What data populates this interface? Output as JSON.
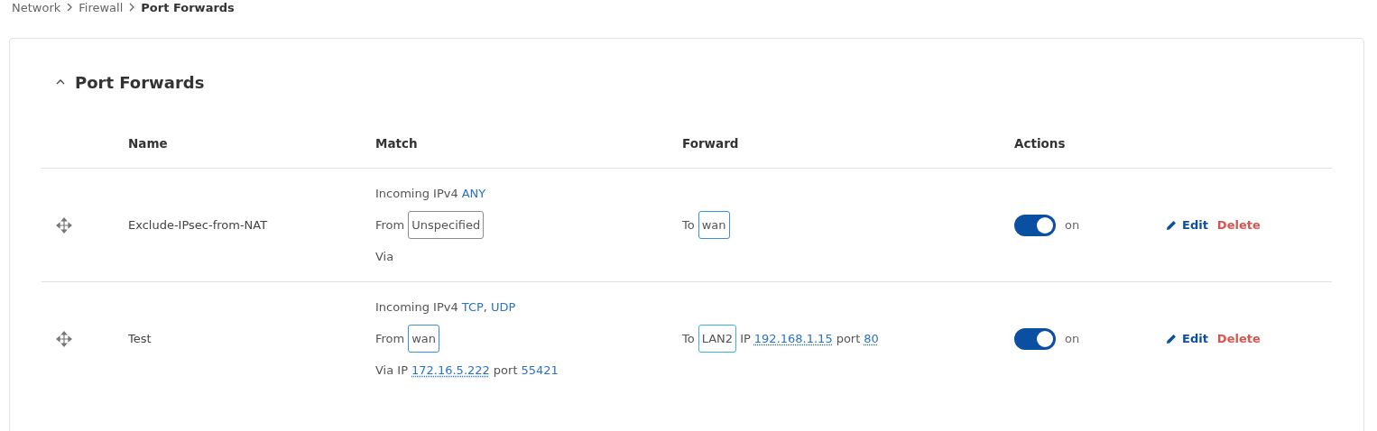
{
  "breadcrumb": [
    {
      "label": "Network",
      "current": false
    },
    {
      "label": "Firewall",
      "current": false
    },
    {
      "label": "Port Forwards",
      "current": true
    }
  ],
  "section": {
    "title": "Port Forwards",
    "expanded": true
  },
  "columns": [
    "Name",
    "Match",
    "Forward",
    "Actions"
  ],
  "rows": [
    {
      "name": "Exclude-IPsec-from-NAT",
      "match": [
        [
          {
            "kind": "text",
            "text": "Incoming IPv4"
          },
          {
            "kind": "link",
            "text": "ANY"
          }
        ],
        [
          {
            "kind": "text",
            "text": "From"
          },
          {
            "kind": "tag",
            "text": "Unspecified",
            "color": "#8c8c8c"
          }
        ],
        [
          {
            "kind": "text",
            "text": "Via"
          }
        ]
      ],
      "forward": [
        [
          {
            "kind": "text",
            "text": "To"
          },
          {
            "kind": "tag",
            "text": "wan",
            "color": "#3a8fd8"
          }
        ]
      ],
      "on": true,
      "status": "on",
      "edit": "Edit",
      "delete": "Delete"
    },
    {
      "name": "Test",
      "match": [
        [
          {
            "kind": "text",
            "text": "Incoming IPv4"
          },
          {
            "kind": "link",
            "text": "TCP"
          },
          {
            "kind": "punct",
            "text": ","
          },
          {
            "kind": "link",
            "text": "UDP"
          }
        ],
        [
          {
            "kind": "text",
            "text": "From"
          },
          {
            "kind": "tag",
            "text": "wan",
            "color": "#3a8fd8"
          }
        ],
        [
          {
            "kind": "text",
            "text": "Via IP"
          },
          {
            "kind": "dotted",
            "text": "172.16.5.222"
          },
          {
            "kind": "text",
            "text": "port"
          },
          {
            "kind": "link",
            "text": "55421"
          }
        ]
      ],
      "forward": [
        [
          {
            "kind": "text",
            "text": "To"
          },
          {
            "kind": "tag",
            "text": "LAN2",
            "color": "#3ab4d0"
          },
          {
            "kind": "text",
            "text": "IP"
          },
          {
            "kind": "dotted",
            "text": "192.168.1.15"
          },
          {
            "kind": "text",
            "text": "port"
          },
          {
            "kind": "dotted",
            "text": "80"
          }
        ]
      ],
      "on": true,
      "status": "on",
      "edit": "Edit",
      "delete": "Delete"
    }
  ]
}
